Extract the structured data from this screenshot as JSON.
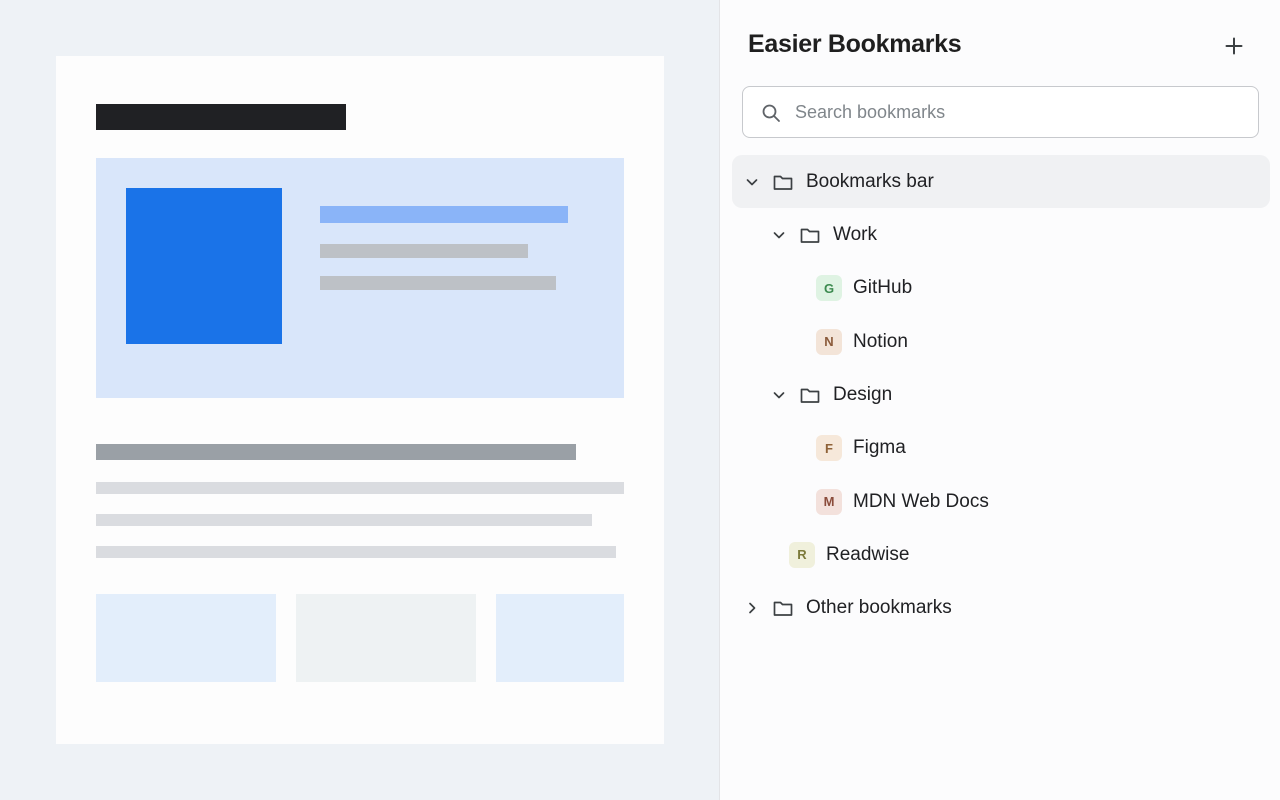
{
  "panel": {
    "title": "Easier Bookmarks",
    "add_label": "+",
    "search": {
      "placeholder": "Search bookmarks",
      "value": ""
    }
  },
  "tree": {
    "bookmarks_bar": {
      "label": "Bookmarks bar",
      "expanded": true,
      "work": {
        "label": "Work",
        "expanded": true,
        "items": [
          {
            "letter": "G",
            "label": "GitHub",
            "bg": "#dff3e3",
            "fg": "#3c8a4f"
          },
          {
            "letter": "N",
            "label": "Notion",
            "bg": "#f3e4d8",
            "fg": "#8a5a3a"
          }
        ]
      },
      "design": {
        "label": "Design",
        "expanded": true,
        "items": [
          {
            "letter": "F",
            "label": "Figma",
            "bg": "#f6e8da",
            "fg": "#8f6238"
          },
          {
            "letter": "M",
            "label": "MDN Web Docs",
            "bg": "#f3e1dc",
            "fg": "#8a4b3b"
          }
        ]
      },
      "readwise": {
        "letter": "R",
        "label": "Readwise",
        "bg": "#f0f0dc",
        "fg": "#7c7a3a"
      }
    },
    "other_bookmarks": {
      "label": "Other bookmarks",
      "expanded": false
    }
  },
  "icons": {
    "chevron_expanded": "chevron-down-icon",
    "chevron_collapsed": "chevron-right-icon",
    "folder": "folder-icon",
    "search": "search-icon",
    "add": "plus-icon"
  },
  "colors": {
    "page_background": "#eef2f6",
    "accent": "#1a73e8",
    "selected_row": "#f0f1f3"
  }
}
